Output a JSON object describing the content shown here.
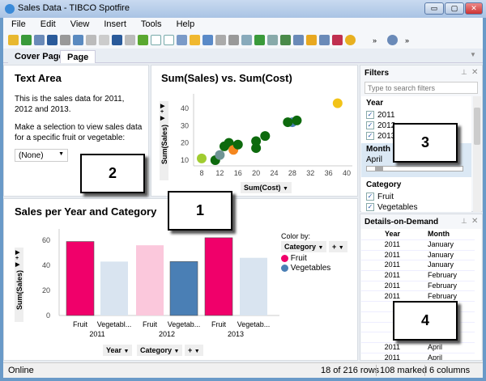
{
  "window": {
    "title": "Sales Data - TIBCO Spotfire",
    "minimize": "▭",
    "maximize": "▢",
    "close": "✕"
  },
  "menu": [
    "File",
    "Edit",
    "View",
    "Insert",
    "Tools",
    "Help"
  ],
  "tabs": [
    "Cover Page",
    "Page"
  ],
  "text_area": {
    "title": "Text Area",
    "para1": "This is the sales data for 2011, 2012 and 2013.",
    "para2": "Make a selection to view sales data for a specific fruit or vegetable:",
    "dropdown_value": "(None)"
  },
  "callouts": [
    "1",
    "2",
    "3",
    "4"
  ],
  "scatter": {
    "title": "Sum(Sales) vs. Sum(Cost)",
    "xlabel": "Sum(Cost)",
    "ylabel": "Sum(Sales)"
  },
  "bar": {
    "title": "Sales per Year and Category",
    "ylabel": "Sum(Sales)",
    "color_by_label": "Color by:",
    "color_by_value": "Category",
    "x_axis_buttons": [
      "Year",
      "Category",
      "+"
    ],
    "legend": [
      {
        "label": "Fruit",
        "color": "#f0006a"
      },
      {
        "label": "Vegetables",
        "color": "#4a7fb5"
      }
    ]
  },
  "filters": {
    "title": "Filters",
    "search_placeholder": "Type to search filters",
    "year_label": "Year",
    "years": [
      "2011",
      "2012",
      "2013"
    ],
    "month_label": "Month",
    "month_value": "April",
    "category_label": "Category",
    "categories": [
      "Fruit",
      "Vegetables"
    ]
  },
  "dod": {
    "title": "Details-on-Demand",
    "headers": [
      "Year",
      "Month"
    ],
    "rows": [
      [
        "2011",
        "January"
      ],
      [
        "2011",
        "January"
      ],
      [
        "2011",
        "January"
      ],
      [
        "2011",
        "February"
      ],
      [
        "2011",
        "February"
      ],
      [
        "2011",
        "February"
      ],
      [
        "",
        ""
      ],
      [
        "",
        ""
      ],
      [
        "",
        ""
      ],
      [
        "",
        ""
      ],
      [
        "2011",
        "April"
      ],
      [
        "2011",
        "April"
      ]
    ]
  },
  "status": {
    "left": "Online",
    "rows": "18 of 216 rows",
    "marked": "108 marked",
    "columns": "6 columns"
  },
  "chart_data": [
    {
      "type": "scatter",
      "title": "Sum(Sales) vs. Sum(Cost)",
      "xlabel": "Sum(Cost)",
      "ylabel": "Sum(Sales)",
      "xlim": [
        7,
        40
      ],
      "ylim": [
        7,
        45
      ],
      "xticks": [
        8,
        12,
        16,
        20,
        24,
        28,
        32,
        36,
        40
      ],
      "yticks": [
        10,
        20,
        30,
        40
      ],
      "points": [
        {
          "x": 8,
          "y": 11,
          "color": "#a0cc30"
        },
        {
          "x": 11,
          "y": 10,
          "color": "#0d6a0d"
        },
        {
          "x": 12,
          "y": 13,
          "color": "#6f9495"
        },
        {
          "x": 13,
          "y": 18,
          "color": "#0d6a0d"
        },
        {
          "x": 14,
          "y": 20,
          "color": "#0d6a0d"
        },
        {
          "x": 15,
          "y": 16,
          "color": "#f5871f"
        },
        {
          "x": 16,
          "y": 19,
          "color": "#0d6a0d"
        },
        {
          "x": 20,
          "y": 17,
          "color": "#0d6a0d"
        },
        {
          "x": 20,
          "y": 21,
          "color": "#0d6a0d"
        },
        {
          "x": 22,
          "y": 24,
          "color": "#0d6a0d"
        },
        {
          "x": 28,
          "y": 32,
          "color": "#4a7fb5"
        },
        {
          "x": 27,
          "y": 32,
          "color": "#0d6a0d"
        },
        {
          "x": 29,
          "y": 33,
          "color": "#0d6a0d"
        },
        {
          "x": 38,
          "y": 43,
          "color": "#f2c318"
        }
      ]
    },
    {
      "type": "bar",
      "title": "Sales per Year and Category",
      "ylabel": "Sum(Sales)",
      "ylim": [
        0,
        70
      ],
      "yticks": [
        0,
        20,
        40,
        60
      ],
      "groups": [
        "2011",
        "2012",
        "2013"
      ],
      "categories": [
        "Fruit",
        "Vegetab..."
      ],
      "bars": [
        {
          "group": "2011",
          "cat": "Fruit",
          "value": 59,
          "color": "#f0006a"
        },
        {
          "group": "2011",
          "cat": "Vegetabl...",
          "value": 43,
          "color": "#d9e4f0"
        },
        {
          "group": "2012",
          "cat": "Fruit",
          "value": 56,
          "color": "#fbc8dc"
        },
        {
          "group": "2012",
          "cat": "Vegetab...",
          "value": 43,
          "color": "#4a7fb5"
        },
        {
          "group": "2013",
          "cat": "Fruit",
          "value": 62,
          "color": "#f0006a"
        },
        {
          "group": "2013",
          "cat": "Vegetab...",
          "value": 46,
          "color": "#d9e4f0"
        }
      ]
    }
  ]
}
